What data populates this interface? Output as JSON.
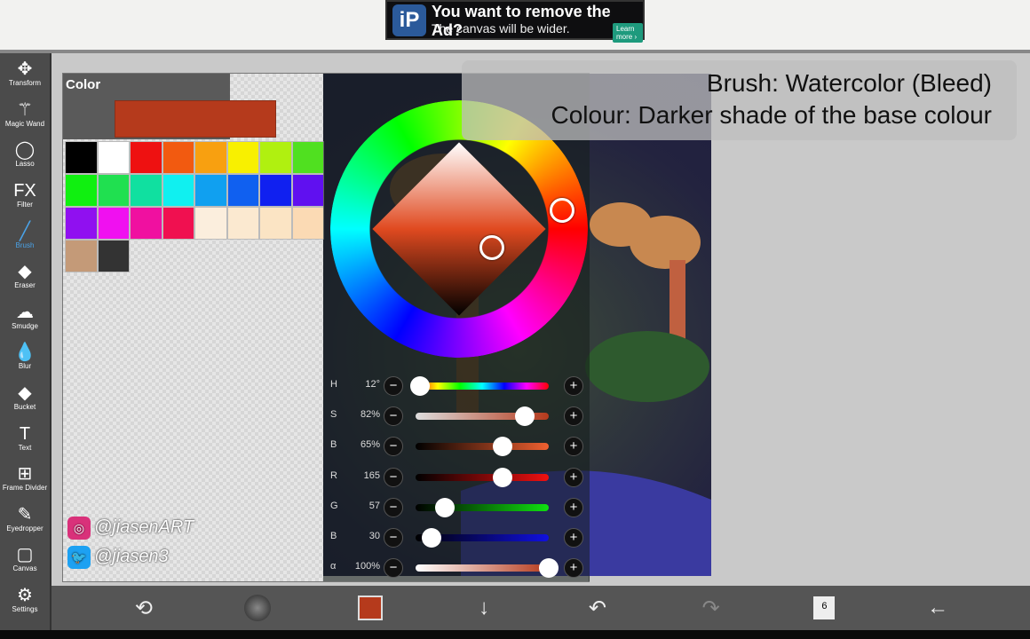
{
  "ad": {
    "title": "You want to remove the Ad?",
    "subtitle": "The canvas will be wider.",
    "button": "Learn more ›",
    "logo": "iP"
  },
  "tools": [
    {
      "label": "Transform",
      "icon": "✥"
    },
    {
      "label": "Magic Wand",
      "icon": "⚚"
    },
    {
      "label": "Lasso",
      "icon": "◯"
    },
    {
      "label": "Filter",
      "icon": "FX"
    },
    {
      "label": "Brush",
      "icon": "╱",
      "active": true
    },
    {
      "label": "Eraser",
      "icon": "◆"
    },
    {
      "label": "Smudge",
      "icon": "☁"
    },
    {
      "label": "Blur",
      "icon": "💧"
    },
    {
      "label": "Bucket",
      "icon": "◆"
    },
    {
      "label": "Text",
      "icon": "T"
    },
    {
      "label": "Frame Divider",
      "icon": "⊞"
    },
    {
      "label": "Eyedropper",
      "icon": "✎"
    },
    {
      "label": "Canvas",
      "icon": "▢"
    },
    {
      "label": "Settings",
      "icon": "⚙"
    }
  ],
  "color_panel": {
    "title": "Color",
    "current_color": "#b53a1c",
    "swatches": [
      "#000000",
      "#ffffff",
      "#ee1111",
      "#f25a10",
      "#f8a010",
      "#f8f000",
      "#b0f010",
      "#50e020",
      "#10f010",
      "#20e050",
      "#10e0a0",
      "#10f0f0",
      "#10a0f0",
      "#1060f0",
      "#1020f0",
      "#6010f0",
      "#9010f0",
      "#f010f0",
      "#f010a0",
      "#f01050",
      "#fbeedd",
      "#fbe9d0",
      "#fbe4c4",
      "#fbdab4",
      "#c49a78",
      "#333333"
    ],
    "sliders": [
      {
        "label": "H",
        "value": "12°",
        "fraction": 0.03,
        "track": "linear-gradient(90deg,#f00,#ff0,#0f0,#0ff,#00f,#f0f,#f00)"
      },
      {
        "label": "S",
        "value": "82%",
        "fraction": 0.82,
        "track": "linear-gradient(90deg,#ddd,#b53a1c)"
      },
      {
        "label": "B",
        "value": "65%",
        "fraction": 0.65,
        "track": "linear-gradient(90deg,#000,#f06030)"
      },
      {
        "label": "R",
        "value": "165",
        "fraction": 0.65,
        "track": "linear-gradient(90deg,#000,#f01010)"
      },
      {
        "label": "G",
        "value": "57",
        "fraction": 0.22,
        "track": "linear-gradient(90deg,#000,#10e010)"
      },
      {
        "label": "B",
        "value": "30",
        "fraction": 0.12,
        "track": "linear-gradient(90deg,#000,#1010e0)"
      },
      {
        "label": "α",
        "value": "100%",
        "fraction": 1.0,
        "track": "linear-gradient(90deg,#fff,#b53a1c)"
      }
    ]
  },
  "caption": {
    "line1": "Brush: Watercolor (Bleed)",
    "line2": "Colour: Darker shade of the base colour"
  },
  "social": {
    "instagram": "@jiasenART",
    "twitter": "@jiasen3"
  },
  "bottom_bar": {
    "layer_count": "6"
  }
}
